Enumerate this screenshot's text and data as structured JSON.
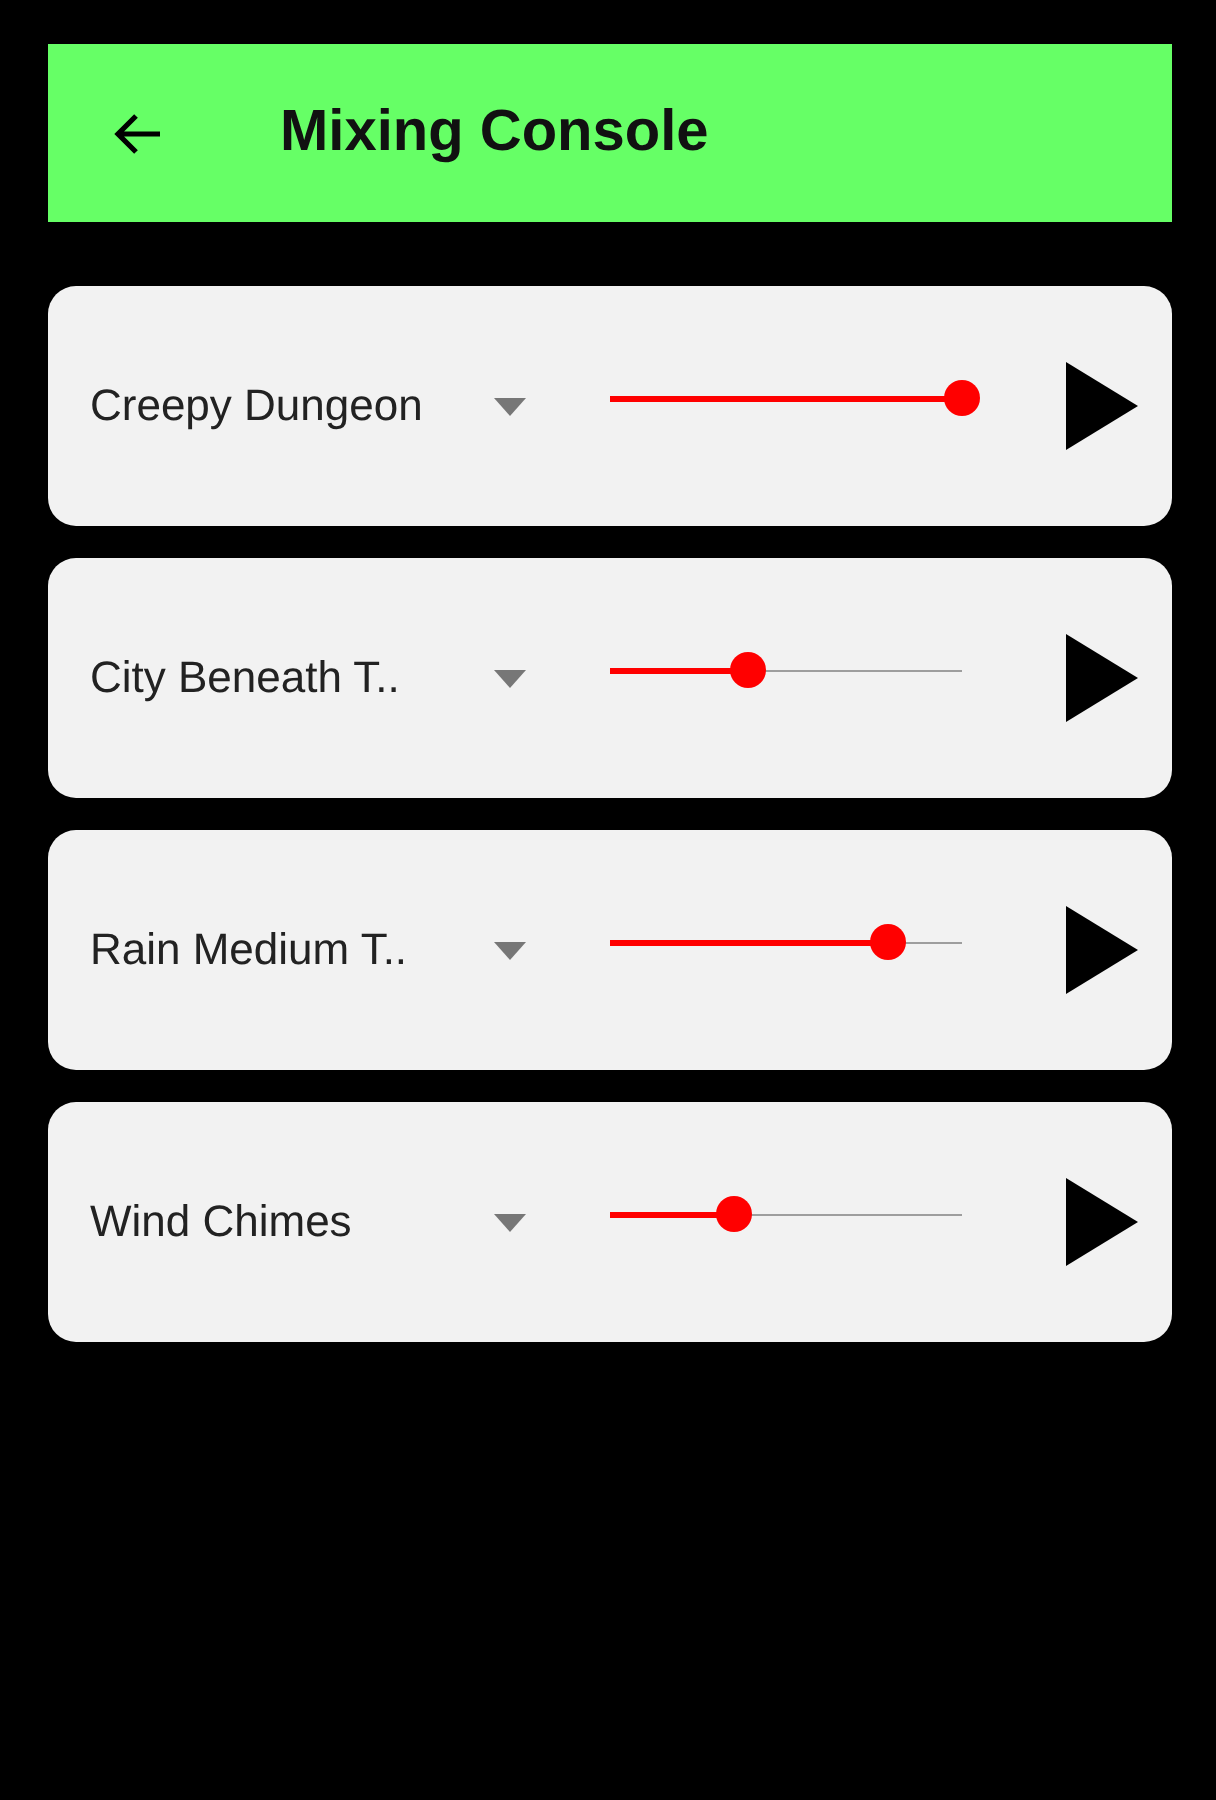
{
  "header": {
    "title": "Mixing Console"
  },
  "sounds": [
    {
      "name": "Creepy Dungeon",
      "level": 1.0
    },
    {
      "name": "City Beneath T..",
      "level": 0.39
    },
    {
      "name": "Rain Medium T..",
      "level": 0.79
    },
    {
      "name": "Wind Chimes",
      "level": 0.35
    }
  ]
}
